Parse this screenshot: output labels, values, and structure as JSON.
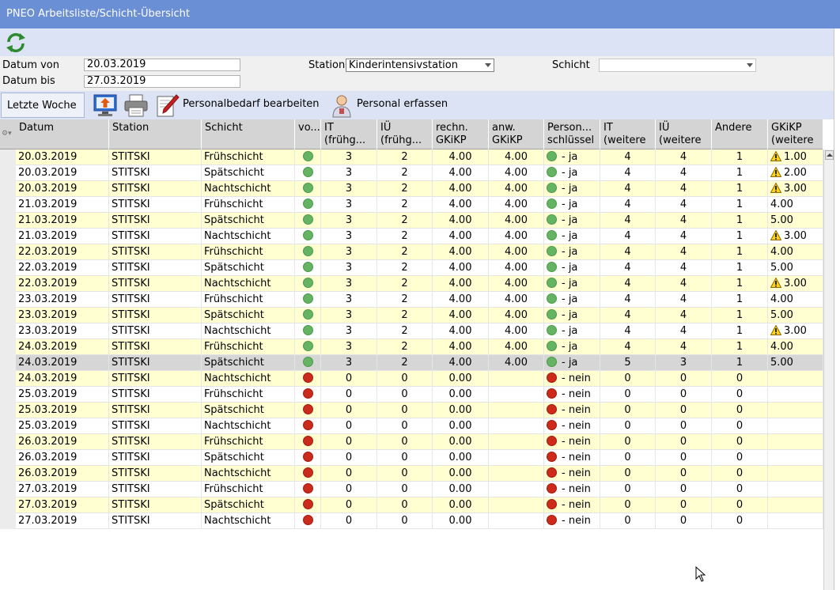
{
  "window": {
    "title": "PNEO Arbeitsliste/Schicht-Übersicht"
  },
  "toolbar": {
    "refresh_icon": "refresh-icon"
  },
  "filters": {
    "datum_von_label": "Datum von",
    "datum_von_value": "20.03.2019",
    "datum_bis_label": "Datum bis",
    "datum_bis_value": "27.03.2019",
    "station_label": "Station",
    "station_value": "Kinderintensivstation",
    "schicht_label": "Schicht",
    "schicht_value": ""
  },
  "actions": {
    "last_week": "Letzte Woche",
    "personalbedarf": "Personalbedarf bearbeiten",
    "personal_erfassen": "Personal erfassen"
  },
  "columns": [
    {
      "line1": "Datum",
      "line2": ""
    },
    {
      "line1": "Station",
      "line2": ""
    },
    {
      "line1": "Schicht",
      "line2": ""
    },
    {
      "line1": "vo...",
      "line2": ""
    },
    {
      "line1": "IT",
      "line2": "(frühg..."
    },
    {
      "line1": "IÜ",
      "line2": "(frühg..."
    },
    {
      "line1": "rechn.",
      "line2": "GKiKP"
    },
    {
      "line1": "anw.",
      "line2": "GKiKP"
    },
    {
      "line1": "Person...",
      "line2": "schlüssel"
    },
    {
      "line1": "IT",
      "line2": "(weitere"
    },
    {
      "line1": "IÜ",
      "line2": "(weitere"
    },
    {
      "line1": "Andere",
      "line2": ""
    },
    {
      "line1": "GKiKP",
      "line2": "(weitere"
    }
  ],
  "colors": {
    "green": "#64b464",
    "red": "#cc2a1a",
    "yellow_row": "#ffffd2"
  },
  "rows": [
    {
      "datum": "20.03.2019",
      "station": "STITSKI",
      "schicht": "Frühschicht",
      "vo": "green",
      "it": "3",
      "iu": "2",
      "rechn": "4.00",
      "anw": "4.00",
      "ps": "green",
      "ps_text": "- ja",
      "itw": "4",
      "iuw": "4",
      "andere": "1",
      "gk_warn": true,
      "gk": "1.00",
      "bg": "yellow"
    },
    {
      "datum": "20.03.2019",
      "station": "STITSKI",
      "schicht": "Spätschicht",
      "vo": "green",
      "it": "3",
      "iu": "2",
      "rechn": "4.00",
      "anw": "4.00",
      "ps": "green",
      "ps_text": "- ja",
      "itw": "4",
      "iuw": "4",
      "andere": "1",
      "gk_warn": true,
      "gk": "2.00",
      "bg": "white"
    },
    {
      "datum": "20.03.2019",
      "station": "STITSKI",
      "schicht": "Nachtschicht",
      "vo": "green",
      "it": "3",
      "iu": "2",
      "rechn": "4.00",
      "anw": "4.00",
      "ps": "green",
      "ps_text": "- ja",
      "itw": "4",
      "iuw": "4",
      "andere": "1",
      "gk_warn": true,
      "gk": "3.00",
      "bg": "yellow"
    },
    {
      "datum": "21.03.2019",
      "station": "STITSKI",
      "schicht": "Frühschicht",
      "vo": "green",
      "it": "3",
      "iu": "2",
      "rechn": "4.00",
      "anw": "4.00",
      "ps": "green",
      "ps_text": "- ja",
      "itw": "4",
      "iuw": "4",
      "andere": "1",
      "gk_warn": false,
      "gk": "4.00",
      "bg": "white"
    },
    {
      "datum": "21.03.2019",
      "station": "STITSKI",
      "schicht": "Spätschicht",
      "vo": "green",
      "it": "3",
      "iu": "2",
      "rechn": "4.00",
      "anw": "4.00",
      "ps": "green",
      "ps_text": "- ja",
      "itw": "4",
      "iuw": "4",
      "andere": "1",
      "gk_warn": false,
      "gk": "5.00",
      "bg": "yellow"
    },
    {
      "datum": "21.03.2019",
      "station": "STITSKI",
      "schicht": "Nachtschicht",
      "vo": "green",
      "it": "3",
      "iu": "2",
      "rechn": "4.00",
      "anw": "4.00",
      "ps": "green",
      "ps_text": "- ja",
      "itw": "4",
      "iuw": "4",
      "andere": "1",
      "gk_warn": true,
      "gk": "3.00",
      "bg": "white"
    },
    {
      "datum": "22.03.2019",
      "station": "STITSKI",
      "schicht": "Frühschicht",
      "vo": "green",
      "it": "3",
      "iu": "2",
      "rechn": "4.00",
      "anw": "4.00",
      "ps": "green",
      "ps_text": "- ja",
      "itw": "4",
      "iuw": "4",
      "andere": "1",
      "gk_warn": false,
      "gk": "4.00",
      "bg": "yellow"
    },
    {
      "datum": "22.03.2019",
      "station": "STITSKI",
      "schicht": "Spätschicht",
      "vo": "green",
      "it": "3",
      "iu": "2",
      "rechn": "4.00",
      "anw": "4.00",
      "ps": "green",
      "ps_text": "- ja",
      "itw": "4",
      "iuw": "4",
      "andere": "1",
      "gk_warn": false,
      "gk": "5.00",
      "bg": "white"
    },
    {
      "datum": "22.03.2019",
      "station": "STITSKI",
      "schicht": "Nachtschicht",
      "vo": "green",
      "it": "3",
      "iu": "2",
      "rechn": "4.00",
      "anw": "4.00",
      "ps": "green",
      "ps_text": "- ja",
      "itw": "4",
      "iuw": "4",
      "andere": "1",
      "gk_warn": true,
      "gk": "3.00",
      "bg": "yellow"
    },
    {
      "datum": "23.03.2019",
      "station": "STITSKI",
      "schicht": "Frühschicht",
      "vo": "green",
      "it": "3",
      "iu": "2",
      "rechn": "4.00",
      "anw": "4.00",
      "ps": "green",
      "ps_text": "- ja",
      "itw": "4",
      "iuw": "4",
      "andere": "1",
      "gk_warn": false,
      "gk": "4.00",
      "bg": "white"
    },
    {
      "datum": "23.03.2019",
      "station": "STITSKI",
      "schicht": "Spätschicht",
      "vo": "green",
      "it": "3",
      "iu": "2",
      "rechn": "4.00",
      "anw": "4.00",
      "ps": "green",
      "ps_text": "- ja",
      "itw": "4",
      "iuw": "4",
      "andere": "1",
      "gk_warn": false,
      "gk": "5.00",
      "bg": "yellow"
    },
    {
      "datum": "23.03.2019",
      "station": "STITSKI",
      "schicht": "Nachtschicht",
      "vo": "green",
      "it": "3",
      "iu": "2",
      "rechn": "4.00",
      "anw": "4.00",
      "ps": "green",
      "ps_text": "- ja",
      "itw": "4",
      "iuw": "4",
      "andere": "1",
      "gk_warn": true,
      "gk": "3.00",
      "bg": "white"
    },
    {
      "datum": "24.03.2019",
      "station": "STITSKI",
      "schicht": "Frühschicht",
      "vo": "green",
      "it": "3",
      "iu": "2",
      "rechn": "4.00",
      "anw": "4.00",
      "ps": "green",
      "ps_text": "- ja",
      "itw": "4",
      "iuw": "4",
      "andere": "1",
      "gk_warn": false,
      "gk": "4.00",
      "bg": "yellow"
    },
    {
      "datum": "24.03.2019",
      "station": "STITSKI",
      "schicht": "Spätschicht",
      "vo": "green",
      "it": "3",
      "iu": "2",
      "rechn": "4.00",
      "anw": "4.00",
      "ps": "green",
      "ps_text": "- ja",
      "itw": "5",
      "iuw": "3",
      "andere": "1",
      "gk_warn": false,
      "gk": "5.00",
      "bg": "selected"
    },
    {
      "datum": "24.03.2019",
      "station": "STITSKI",
      "schicht": "Nachtschicht",
      "vo": "red",
      "it": "0",
      "iu": "0",
      "rechn": "0.00",
      "anw": "",
      "ps": "red",
      "ps_text": "- nein",
      "itw": "0",
      "iuw": "0",
      "andere": "0",
      "gk_warn": false,
      "gk": "",
      "bg": "yellow"
    },
    {
      "datum": "25.03.2019",
      "station": "STITSKI",
      "schicht": "Frühschicht",
      "vo": "red",
      "it": "0",
      "iu": "0",
      "rechn": "0.00",
      "anw": "",
      "ps": "red",
      "ps_text": "- nein",
      "itw": "0",
      "iuw": "0",
      "andere": "0",
      "gk_warn": false,
      "gk": "",
      "bg": "white"
    },
    {
      "datum": "25.03.2019",
      "station": "STITSKI",
      "schicht": "Spätschicht",
      "vo": "red",
      "it": "0",
      "iu": "0",
      "rechn": "0.00",
      "anw": "",
      "ps": "red",
      "ps_text": "- nein",
      "itw": "0",
      "iuw": "0",
      "andere": "0",
      "gk_warn": false,
      "gk": "",
      "bg": "yellow"
    },
    {
      "datum": "25.03.2019",
      "station": "STITSKI",
      "schicht": "Nachtschicht",
      "vo": "red",
      "it": "0",
      "iu": "0",
      "rechn": "0.00",
      "anw": "",
      "ps": "red",
      "ps_text": "- nein",
      "itw": "0",
      "iuw": "0",
      "andere": "0",
      "gk_warn": false,
      "gk": "",
      "bg": "white"
    },
    {
      "datum": "26.03.2019",
      "station": "STITSKI",
      "schicht": "Frühschicht",
      "vo": "red",
      "it": "0",
      "iu": "0",
      "rechn": "0.00",
      "anw": "",
      "ps": "red",
      "ps_text": "- nein",
      "itw": "0",
      "iuw": "0",
      "andere": "0",
      "gk_warn": false,
      "gk": "",
      "bg": "yellow"
    },
    {
      "datum": "26.03.2019",
      "station": "STITSKI",
      "schicht": "Spätschicht",
      "vo": "red",
      "it": "0",
      "iu": "0",
      "rechn": "0.00",
      "anw": "",
      "ps": "red",
      "ps_text": "- nein",
      "itw": "0",
      "iuw": "0",
      "andere": "0",
      "gk_warn": false,
      "gk": "",
      "bg": "white"
    },
    {
      "datum": "26.03.2019",
      "station": "STITSKI",
      "schicht": "Nachtschicht",
      "vo": "red",
      "it": "0",
      "iu": "0",
      "rechn": "0.00",
      "anw": "",
      "ps": "red",
      "ps_text": "- nein",
      "itw": "0",
      "iuw": "0",
      "andere": "0",
      "gk_warn": false,
      "gk": "",
      "bg": "yellow"
    },
    {
      "datum": "27.03.2019",
      "station": "STITSKI",
      "schicht": "Frühschicht",
      "vo": "red",
      "it": "0",
      "iu": "0",
      "rechn": "0.00",
      "anw": "",
      "ps": "red",
      "ps_text": "- nein",
      "itw": "0",
      "iuw": "0",
      "andere": "0",
      "gk_warn": false,
      "gk": "",
      "bg": "white"
    },
    {
      "datum": "27.03.2019",
      "station": "STITSKI",
      "schicht": "Spätschicht",
      "vo": "red",
      "it": "0",
      "iu": "0",
      "rechn": "0.00",
      "anw": "",
      "ps": "red",
      "ps_text": "- nein",
      "itw": "0",
      "iuw": "0",
      "andere": "0",
      "gk_warn": false,
      "gk": "",
      "bg": "yellow"
    },
    {
      "datum": "27.03.2019",
      "station": "STITSKI",
      "schicht": "Nachtschicht",
      "vo": "red",
      "it": "0",
      "iu": "0",
      "rechn": "0.00",
      "anw": "",
      "ps": "red",
      "ps_text": "- nein",
      "itw": "0",
      "iuw": "0",
      "andere": "0",
      "gk_warn": false,
      "gk": "",
      "bg": "white"
    }
  ]
}
